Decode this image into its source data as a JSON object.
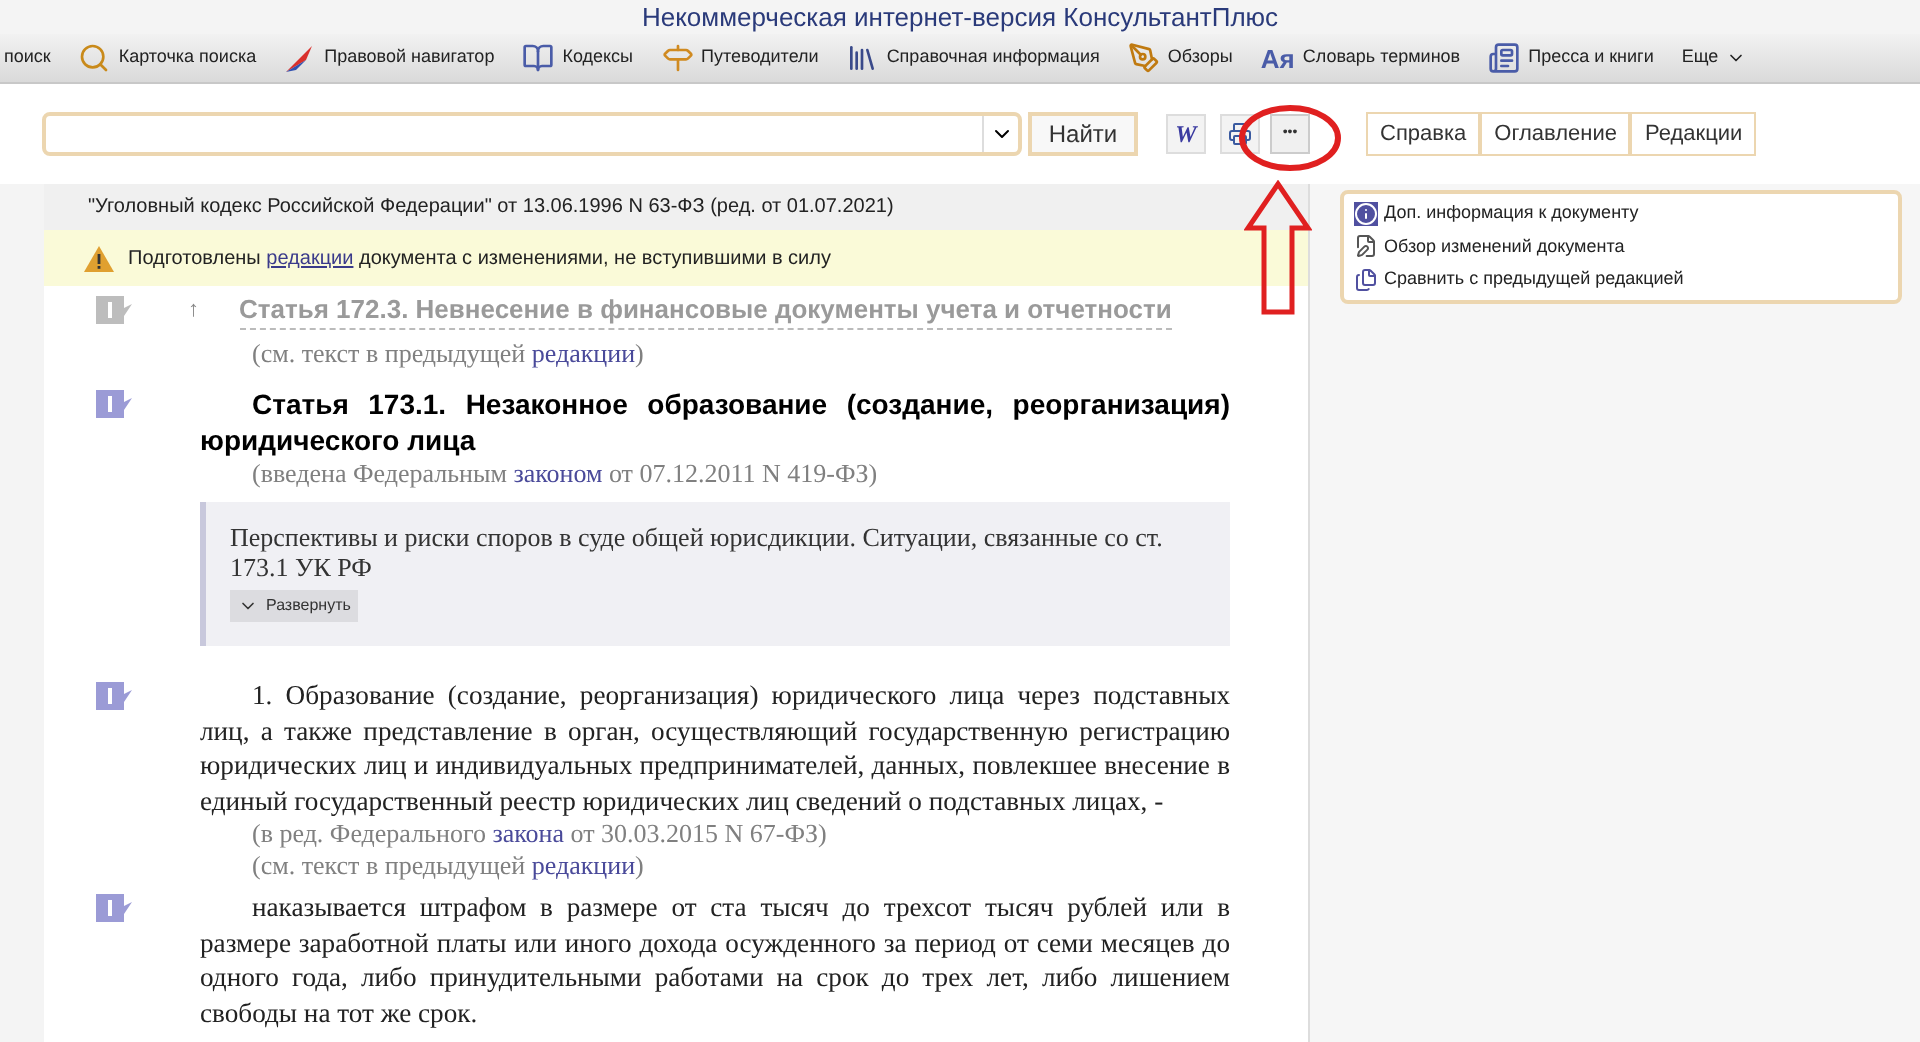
{
  "window": {
    "title": "Некоммерческая интернет-версия КонсультантПлюс"
  },
  "toolbar": {
    "items": [
      {
        "kind": "text",
        "label": "поиск"
      },
      {
        "kind": "card",
        "label": "Карточка поиска"
      },
      {
        "kind": "navigator",
        "label": "Правовой навигатор"
      },
      {
        "kind": "codes",
        "label": "Кодексы"
      },
      {
        "kind": "guides",
        "label": "Путеводители"
      },
      {
        "kind": "reference",
        "label": "Справочная информация"
      },
      {
        "kind": "reviews",
        "label": "Обзоры"
      },
      {
        "kind": "dictionary",
        "glyph": "Ая",
        "label": "Словарь терминов"
      },
      {
        "kind": "press",
        "label": "Пресса и книги"
      },
      {
        "kind": "more",
        "label": "Еще"
      }
    ]
  },
  "search": {
    "button": "Найти"
  },
  "tools": {
    "word": "W",
    "more": "•••"
  },
  "tabs": [
    {
      "label": "Справка"
    },
    {
      "label": "Оглавление"
    },
    {
      "label": "Редакции"
    }
  ],
  "document": {
    "header": "\"Уголовный кодекс Российской Федерации\" от 13.06.1996 N 63-ФЗ (ред. от 01.07.2021)",
    "warning": {
      "before": "Подготовлены ",
      "link": "редакции",
      "after": " документа с изменениями, не вступившими в силу"
    },
    "sticky": {
      "arrow": "↑",
      "text": "Статья 172.3. Невнесение в финансовые документы учета и отчетности"
    },
    "blocks": [
      {
        "kind": "note",
        "icon": false,
        "before": "(см. текст в предыдущей ",
        "link": "редакции",
        "after": ")"
      },
      {
        "kind": "heading",
        "icon": true,
        "text": "Статья 173.1. Незаконное образование (создание, реорганизация) юридического лица"
      },
      {
        "kind": "note",
        "icon": false,
        "before": "(введена Федеральным ",
        "link": "законом",
        "after": " от 07.12.2011 N 419-ФЗ)"
      },
      {
        "kind": "related",
        "icon": false,
        "text": "Перспективы и риски споров в суде общей юрисдикции. Ситуации, связанные со ст. 173.1 УК РФ",
        "button": "Развернуть"
      },
      {
        "kind": "paragraph",
        "icon": true,
        "text": "1. Образование (создание, реорганизация) юридического лица через подставных лиц, а также представление в орган, осуществляющий государственную регистрацию юридических лиц и индивидуальных предпринимателей, данных, повлекшее внесение в единый государственный реестр юридических лиц сведений о подставных лицах, -"
      },
      {
        "kind": "note",
        "icon": false,
        "before": "(в ред. Федерального ",
        "link": "закона",
        "after": " от 30.03.2015 N 67-ФЗ)"
      },
      {
        "kind": "note",
        "icon": false,
        "before": "(см. текст в предыдущей ",
        "link": "редакции",
        "after": ")"
      },
      {
        "kind": "paragraph",
        "icon": true,
        "text": "наказывается штрафом в размере от ста тысяч до трехсот тысяч рублей или в размере заработной платы или иного дохода осужденного за период от семи месяцев до одного года, либо принудительными работами на срок до трех лет, либо лишением свободы на тот же срок."
      }
    ]
  },
  "side_menu": [
    {
      "kind": "info",
      "label": "Доп. информация к документу"
    },
    {
      "kind": "review",
      "label": "Обзор изменений документа"
    },
    {
      "kind": "compare",
      "label": "Сравнить с предыдущей редакцией"
    }
  ]
}
